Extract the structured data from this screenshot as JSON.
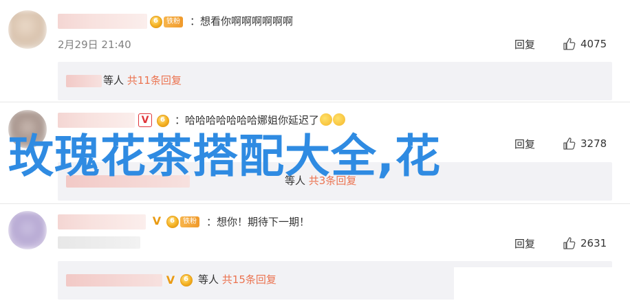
{
  "comments": [
    {
      "text": "：想看你啊啊啊啊啊啊",
      "time": "2月29日 21:40",
      "reply_label": "回复",
      "likes": "4075",
      "sub_prefix": "等人",
      "sub_count": "共11条回复"
    },
    {
      "text": "：哈哈哈哈哈哈哈娜姐你延迟了",
      "reply_label": "回复",
      "likes": "3278",
      "sub_prefix": "等人",
      "sub_count": "共3条回复"
    },
    {
      "text": "：想你！期待下一期！",
      "reply_label": "回复",
      "likes": "2631",
      "sub_prefix": "等人",
      "sub_count": "共15条回复"
    }
  ],
  "badge": {
    "fan_tag": "铁粉"
  },
  "overlay_title": "玫瑰花茶搭配大全,花",
  "colors": {
    "accent": "#eb7350",
    "overlay": "#2f8be2",
    "subbg": "#f2f2f5"
  },
  "icons": [
    "like-icon",
    "fan-medal-icon",
    "vip-icon",
    "emoji-icon"
  ]
}
